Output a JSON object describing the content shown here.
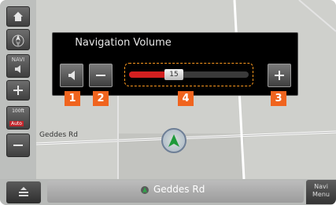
{
  "popup": {
    "title": "Navigation Volume",
    "volume_level": 15,
    "volume_max": 40
  },
  "callouts": [
    "1",
    "2",
    "4",
    "3"
  ],
  "sidebar": {
    "navi_label": "NAVI",
    "scale_label": "100ft",
    "auto_label": "Auto"
  },
  "map": {
    "road_label": "Geddes Rd"
  },
  "bottom_bar": {
    "street": "Geddes Rd",
    "navi_menu_line1": "Navi",
    "navi_menu_line2": "Menu"
  },
  "colors": {
    "callout": "#f0641e",
    "volume_fill": "#d32020",
    "focus_outline": "#ff9a1e"
  },
  "icons": [
    "home-icon",
    "compass-icon",
    "speaker-icon",
    "plus-icon",
    "minus-icon",
    "menu-icon",
    "location-arrow-icon"
  ]
}
